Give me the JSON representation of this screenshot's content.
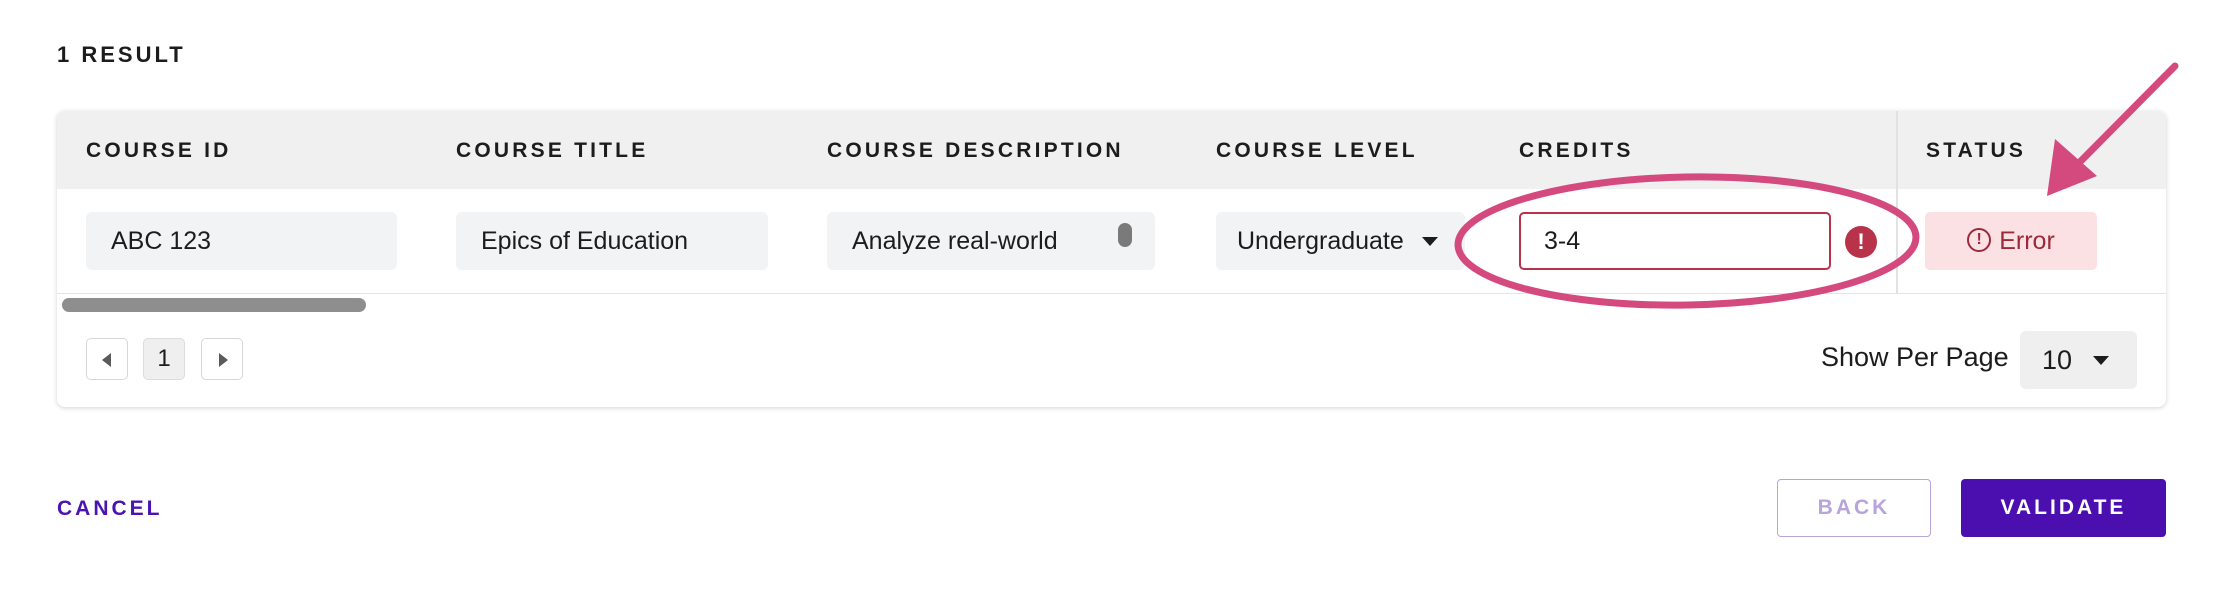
{
  "results": {
    "count_label": "1 RESULT"
  },
  "table": {
    "columns": [
      "COURSE ID",
      "COURSE TITLE",
      "COURSE DESCRIPTION",
      "COURSE LEVEL",
      "CREDITS",
      "STATUS"
    ],
    "rows": [
      {
        "course_id": "ABC 123",
        "course_title": "Epics of Education",
        "course_description": "Analyze real-world",
        "course_level": "Undergraduate",
        "credits": "3-4",
        "credits_error_icon": "!",
        "status": "Error",
        "status_icon": "!"
      }
    ]
  },
  "pagination": {
    "current_page": "1",
    "per_page_label": "Show Per Page",
    "per_page_value": "10"
  },
  "footer": {
    "cancel_label": "CANCEL",
    "back_label": "BACK",
    "validate_label": "VALIDATE"
  },
  "colors": {
    "primary": "#4b0fb0",
    "error": "#b8324a",
    "error_bg": "#fbe1e3",
    "annotation": "#d44a7e"
  },
  "icons": {
    "prev": "chevron-left-icon",
    "next": "chevron-right-icon",
    "dropdown": "caret-down-icon",
    "error": "exclamation-circle-icon"
  }
}
